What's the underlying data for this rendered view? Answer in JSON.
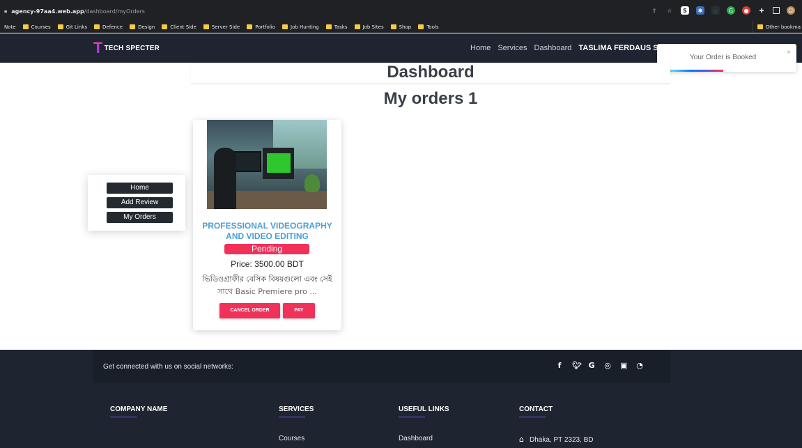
{
  "browser": {
    "url_host": "agency-97aa4.web.app",
    "url_path": "/dashboard/myOrders",
    "bookmarks": [
      "Note",
      "Courses",
      "Git Links",
      "Defence",
      "Design",
      "Client Side",
      "Server Side",
      "Portfolio",
      "Job Hunting",
      "Tasks",
      "Job Sites",
      "Shop",
      "Tools"
    ],
    "other_bookmarks": "Other bookma"
  },
  "navbar": {
    "logo_mark": "T",
    "logo_text": "TECH SPECTER",
    "links": [
      "Home",
      "Services",
      "Dashboard"
    ],
    "user": "TASLIMA FERDAUS SHUVA"
  },
  "toast": {
    "message": "Your Order is Booked",
    "close": "×"
  },
  "page": {
    "title": "Dashboard",
    "orders_heading": "My orders 1"
  },
  "sidebar": {
    "items": [
      "Home",
      "Add Review",
      "My Orders"
    ]
  },
  "order": {
    "name": "PROFESSIONAL VIDEOGRAPHY AND VIDEO EDITING",
    "status": "Pending",
    "price": "Price: 3500.00 BDT",
    "description_line1": "ভিডিওগ্রাফীর বেসিক বিষয়গুলো এবং সেই",
    "description_line2": "সাথে Basic Premiere pro ...",
    "cancel_label": "CANCEL ORDER",
    "pay_label": "PAY"
  },
  "footer": {
    "social_text": "Get connected with us on social networks:",
    "social_icons": [
      "facebook-icon",
      "twitter-icon",
      "google-icon",
      "instagram-icon",
      "linkedin-icon",
      "github-icon"
    ],
    "columns": {
      "company": {
        "heading": "COMPANY NAME"
      },
      "services": {
        "heading": "SERVICES",
        "first_item": "Courses"
      },
      "useful_links": {
        "heading": "USEFUL LINKS",
        "first_item": "Dashboard"
      },
      "contact": {
        "heading": "CONTACT",
        "first_item": "Dhaka, PT 2323, BD"
      }
    }
  },
  "colors": {
    "navbar": "#1e2430",
    "accent_pink": "#f0315a",
    "service_title": "#4a9ed6"
  }
}
